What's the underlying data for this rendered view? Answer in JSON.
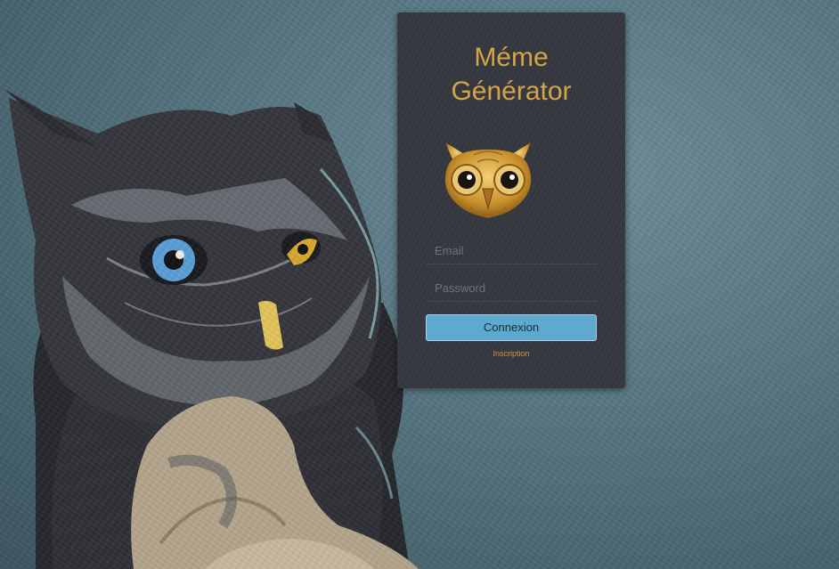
{
  "app": {
    "title_line1": "Méme",
    "title_line2": "Générator"
  },
  "login": {
    "email_placeholder": "Email",
    "password_placeholder": "Password",
    "submit_label": "Connexion",
    "signup_label": "Inscription"
  },
  "colors": {
    "accent_gold": "#d4a44a",
    "button_blue": "#5fa8cf",
    "card_bg": "#36383f",
    "background": "#587884"
  },
  "icons": {
    "logo": "owl-logo-icon",
    "background": "owl-illustration"
  }
}
